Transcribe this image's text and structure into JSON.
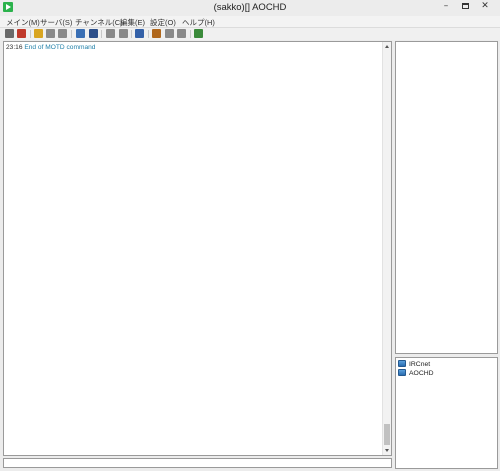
{
  "window": {
    "title": "(sakko)[] AOCHD",
    "min_glyph": "–",
    "close_glyph": "✕"
  },
  "menu": {
    "items": [
      "メイン(M)",
      "サーバ(S)",
      "チャンネル(C)",
      "編集(E)",
      "設定(O)",
      "ヘルプ(H)"
    ]
  },
  "toolbar": {
    "buttons": [
      {
        "icon": "server-icon",
        "color": "#6a6a6a"
      },
      {
        "icon": "disconnect-icon",
        "color": "#c0392b"
      },
      {
        "icon": "channel-join-icon",
        "color": "#d9a520"
      },
      {
        "icon": "channel-part-icon",
        "color": "#8a8a8a"
      },
      {
        "icon": "channel-list-icon",
        "color": "#8a8a8a"
      },
      {
        "icon": "whois-icon",
        "color": "#3a6fb4"
      },
      {
        "icon": "query-icon",
        "color": "#2c4f8a"
      },
      {
        "icon": "lock-icon",
        "color": "#8a8a8a"
      },
      {
        "icon": "kick-icon",
        "color": "#8a8a8a"
      },
      {
        "icon": "mode-icon",
        "color": "#3461a8"
      },
      {
        "icon": "search-icon",
        "color": "#b0681d"
      },
      {
        "icon": "ban-icon",
        "color": "#8a8a8a"
      },
      {
        "icon": "op-icon",
        "color": "#8a8a8a"
      },
      {
        "icon": "log-icon",
        "color": "#3a8a3a"
      }
    ]
  },
  "chat": {
    "lines": [
      {
        "time": "23:16",
        "message": "End of MOTD command"
      }
    ]
  },
  "channels": {
    "items": [
      {
        "label": "IRCnet"
      },
      {
        "label": "AOCHD"
      }
    ]
  },
  "colors": {
    "accent": "#2bb24c",
    "log_message": "#1f7fa8"
  }
}
